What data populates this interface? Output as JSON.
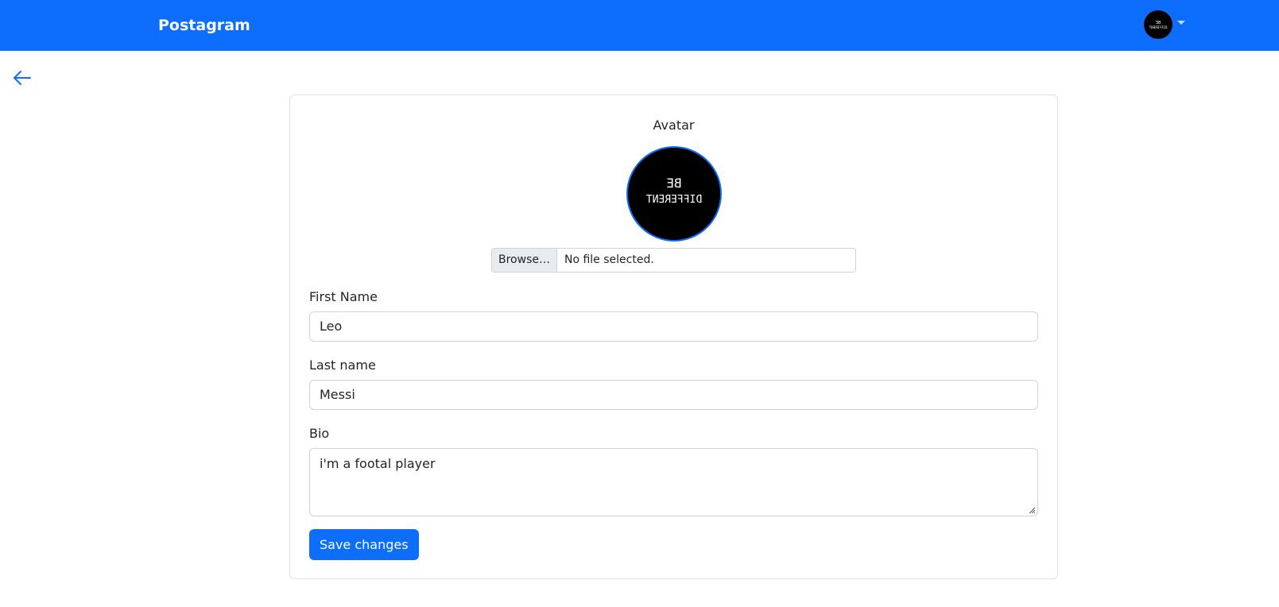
{
  "navbar": {
    "brand": "Postagram",
    "avatar_icon": "user-avatar-icon",
    "dropdown_icon": "caret-down-icon",
    "color": "#0d6efd"
  },
  "back_icon": "arrow-left-icon",
  "form": {
    "avatar_label": "Avatar",
    "avatar_text_line1": "BE",
    "avatar_text_line2": "DIFFERENT",
    "file_browse_label": "Browse…",
    "file_status": "No file selected.",
    "first_name_label": "First Name",
    "first_name_value": "Leo",
    "last_name_label": "Last name",
    "last_name_value": "Messi",
    "bio_label": "Bio",
    "bio_value": "i'm a footal player",
    "save_label": "Save changes"
  },
  "colors": {
    "accent": "#0d6efd",
    "border": "#ced4da",
    "text": "#212529"
  }
}
